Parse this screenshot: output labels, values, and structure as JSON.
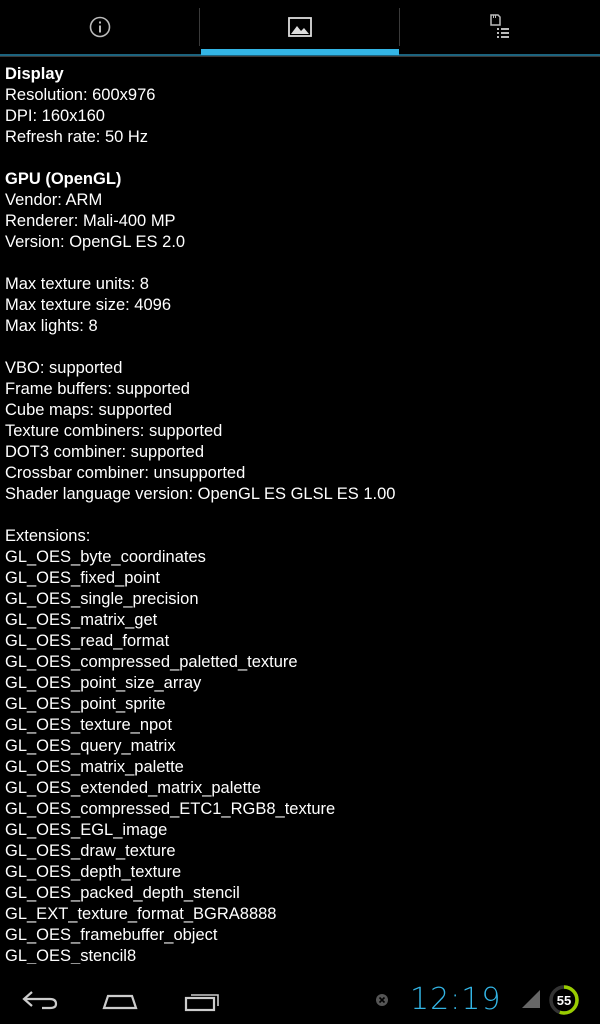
{
  "tabs": [
    {
      "icon": "info-icon"
    },
    {
      "icon": "image-icon"
    },
    {
      "icon": "sd-list-icon"
    }
  ],
  "content": {
    "lines": [
      {
        "text": "Display",
        "bold": true
      },
      {
        "text": "Resolution: 600x976"
      },
      {
        "text": "DPI: 160x160"
      },
      {
        "text": "Refresh rate: 50 Hz"
      },
      {
        "text": ""
      },
      {
        "text": "GPU (OpenGL)",
        "bold": true
      },
      {
        "text": "Vendor: ARM"
      },
      {
        "text": "Renderer: Mali-400 MP"
      },
      {
        "text": "Version: OpenGL ES 2.0"
      },
      {
        "text": ""
      },
      {
        "text": "Max texture units: 8"
      },
      {
        "text": "Max texture size: 4096"
      },
      {
        "text": "Max lights: 8"
      },
      {
        "text": ""
      },
      {
        "text": "VBO: supported"
      },
      {
        "text": "Frame buffers: supported"
      },
      {
        "text": "Cube maps: supported"
      },
      {
        "text": "Texture combiners: supported"
      },
      {
        "text": "DOT3 combiner: supported"
      },
      {
        "text": "Crossbar combiner: unsupported"
      },
      {
        "text": "Shader language version: OpenGL ES GLSL ES 1.00"
      },
      {
        "text": ""
      },
      {
        "text": "Extensions:"
      },
      {
        "text": "GL_OES_byte_coordinates"
      },
      {
        "text": "GL_OES_fixed_point"
      },
      {
        "text": "GL_OES_single_precision"
      },
      {
        "text": "GL_OES_matrix_get"
      },
      {
        "text": "GL_OES_read_format"
      },
      {
        "text": "GL_OES_compressed_paletted_texture"
      },
      {
        "text": "GL_OES_point_size_array"
      },
      {
        "text": "GL_OES_point_sprite"
      },
      {
        "text": "GL_OES_texture_npot"
      },
      {
        "text": "GL_OES_query_matrix"
      },
      {
        "text": "GL_OES_matrix_palette"
      },
      {
        "text": "GL_OES_extended_matrix_palette"
      },
      {
        "text": "GL_OES_compressed_ETC1_RGB8_texture"
      },
      {
        "text": "GL_OES_EGL_image"
      },
      {
        "text": "GL_OES_draw_texture"
      },
      {
        "text": "GL_OES_depth_texture"
      },
      {
        "text": "GL_OES_packed_depth_stencil"
      },
      {
        "text": "GL_EXT_texture_format_BGRA8888"
      },
      {
        "text": "GL_OES_framebuffer_object"
      },
      {
        "text": "GL_OES_stencil8"
      }
    ]
  },
  "navbar": {
    "buttons": [
      "back-icon",
      "home-icon",
      "recent-apps-icon"
    ]
  },
  "status": {
    "notification_icon": "close-circle-icon",
    "time": "12:19",
    "signal_icon": "signal-icon",
    "battery_level": "55"
  },
  "colors": {
    "accent": "#33b5e5",
    "battery_ring": "#99cc00",
    "background": "#000000",
    "text": "#ffffff"
  }
}
